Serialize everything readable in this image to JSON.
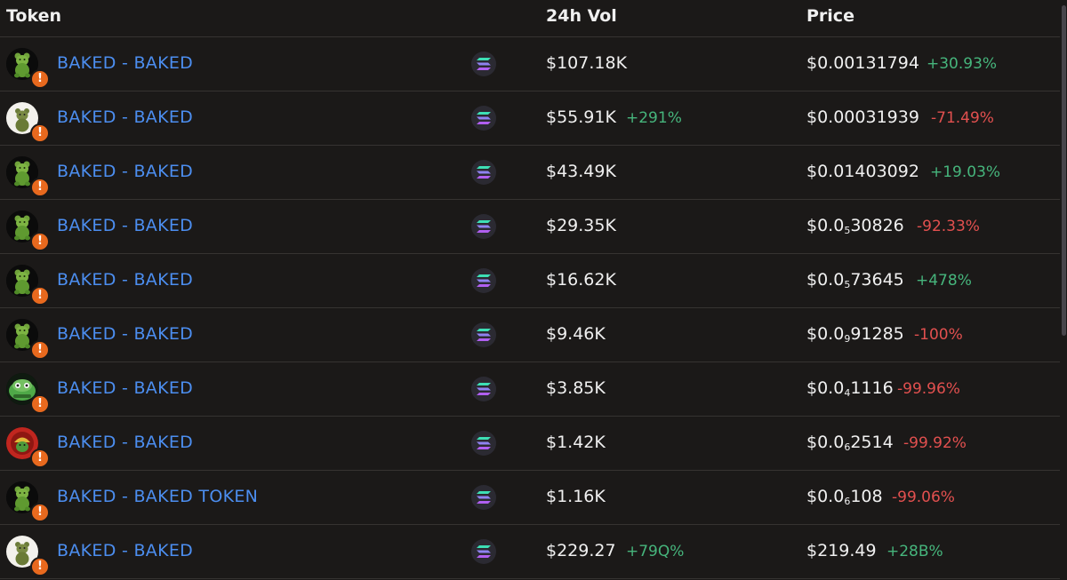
{
  "header": {
    "token": "Token",
    "vol": "24h Vol",
    "price": "Price"
  },
  "warning_icon": "warning-icon",
  "chain_icon": "solana-icon",
  "rows": [
    {
      "name": "BAKED - BAKED",
      "avatar": "gummy-bear",
      "vol": "$107.18K",
      "vol_change": "",
      "price_pre": "$0.00131794",
      "price_sub": "",
      "price_post": "",
      "price_change": "+30.93%",
      "dir": "up"
    },
    {
      "name": "BAKED - BAKED",
      "avatar": "bear-white",
      "vol": "$55.91K",
      "vol_change": "+291%",
      "price_pre": "$0.00031939",
      "price_sub": "",
      "price_post": "",
      "price_change": "-71.49%",
      "dir": "down"
    },
    {
      "name": "BAKED - BAKED",
      "avatar": "gummy-bear",
      "vol": "$43.49K",
      "vol_change": "",
      "price_pre": "$0.01403092",
      "price_sub": "",
      "price_post": "",
      "price_change": "+19.03%",
      "dir": "up"
    },
    {
      "name": "BAKED - BAKED",
      "avatar": "gummy-bear",
      "vol": "$29.35K",
      "vol_change": "",
      "price_pre": "$0.0",
      "price_sub": "5",
      "price_post": "30826",
      "price_change": "-92.33%",
      "dir": "down"
    },
    {
      "name": "BAKED - BAKED",
      "avatar": "gummy-bear",
      "vol": "$16.62K",
      "vol_change": "",
      "price_pre": "$0.0",
      "price_sub": "5",
      "price_post": "73645",
      "price_change": "+478%",
      "dir": "up"
    },
    {
      "name": "BAKED - BAKED",
      "avatar": "gummy-bear",
      "vol": "$9.46K",
      "vol_change": "",
      "price_pre": "$0.0",
      "price_sub": "9",
      "price_post": "91285",
      "price_change": "-100%",
      "dir": "down"
    },
    {
      "name": "BAKED - BAKED",
      "avatar": "green-creature",
      "vol": "$3.85K",
      "vol_change": "",
      "price_pre": "$0.0",
      "price_sub": "4",
      "price_post": "1116",
      "price_change": "-99.96%",
      "dir": "down"
    },
    {
      "name": "BAKED - BAKED",
      "avatar": "red-badge",
      "vol": "$1.42K",
      "vol_change": "",
      "price_pre": "$0.0",
      "price_sub": "6",
      "price_post": "2514",
      "price_change": "-99.92%",
      "dir": "down"
    },
    {
      "name": "BAKED - BAKED TOKEN",
      "avatar": "gummy-bear",
      "vol": "$1.16K",
      "vol_change": "",
      "price_pre": "$0.0",
      "price_sub": "6",
      "price_post": "108",
      "price_change": "-99.06%",
      "dir": "down"
    },
    {
      "name": "BAKED - BAKED",
      "avatar": "bear-white",
      "vol": "$229.27",
      "vol_change": "+79Q%",
      "price_pre": "$219.49",
      "price_sub": "",
      "price_post": "",
      "price_change": "+28B%",
      "dir": "up"
    }
  ]
}
